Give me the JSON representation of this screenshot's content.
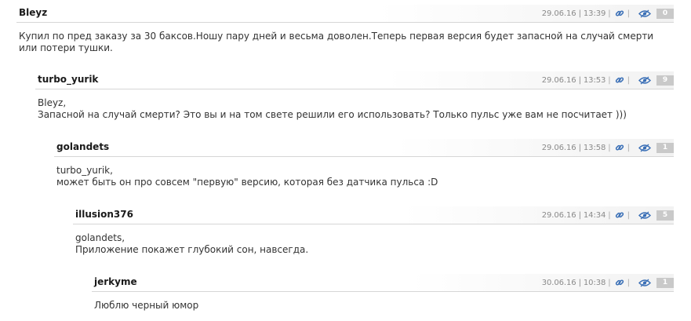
{
  "comments": [
    {
      "author": "Bleyz",
      "date": "29.06.16 | 13:39",
      "rating": "0",
      "text": "Купил по пред заказу за 30 баксов.Ношу пару дней и весьма доволен.Теперь первая версия будет запасной на случай смерти или потери тушки."
    },
    {
      "author": "turbo_yurik",
      "date": "29.06.16 | 13:53",
      "rating": "9",
      "text": "Bleyz,\nЗапасной на случай смерти? Это вы и на том свете решили его использовать? Только пульс уже вам не посчитает )))"
    },
    {
      "author": "golandets",
      "date": "29.06.16 | 13:58",
      "rating": "1",
      "text": "turbo_yurik,\nможет быть он про совсем \"первую\" версию, которая без датчика пульса :D"
    },
    {
      "author": "illusion376",
      "date": "29.06.16 | 14:34",
      "rating": "5",
      "text": "golandets,\nПриложение покажет глубокий сон, навсегда."
    },
    {
      "author": "jerkyme",
      "date": "30.06.16 | 10:38",
      "rating": "1",
      "text": "Люблю черный юмор"
    }
  ],
  "icons": {
    "link": "link-icon",
    "eye": "eye-icon"
  },
  "colors": {
    "icon_blue": "#3a6fb6",
    "rating_bg": "#c9c9c9",
    "date_gray": "#8a8a8a"
  }
}
